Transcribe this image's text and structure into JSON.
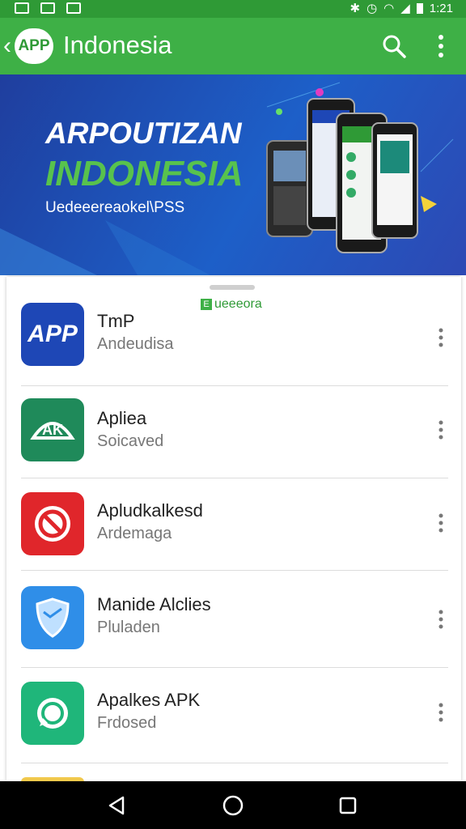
{
  "status_bar": {
    "time": "1:21"
  },
  "app_bar": {
    "logo_text": "APP",
    "title": "Indonesia"
  },
  "banner": {
    "line1": "ARPOUTIZAN",
    "line2": "INDONESIA",
    "line3": "Uedeeereaokel\\PSS"
  },
  "list_header": {
    "tag_icon": "E",
    "tag": "ueeeora"
  },
  "apps": [
    {
      "name": "TmP",
      "subtitle": "Andeudisa",
      "icon": "app-logo-icon",
      "icon_text": "APP",
      "color": "#1e47b6"
    },
    {
      "name": "Apliea",
      "subtitle": "Soicaved",
      "icon": "ak-logo-icon",
      "icon_text": "AK",
      "color": "#1f8a5a"
    },
    {
      "name": "Apludkalkesd",
      "subtitle": "Ardemaga",
      "icon": "block-icon",
      "color": "#e0262b"
    },
    {
      "name": "Manide Alclies",
      "subtitle": "Pluladen",
      "icon": "shield-icon",
      "color": "#2f8ee8"
    },
    {
      "name": "Apalkes APK",
      "subtitle": "Frdosed",
      "icon": "whatsapp-icon",
      "color": "#1fb67a"
    }
  ]
}
